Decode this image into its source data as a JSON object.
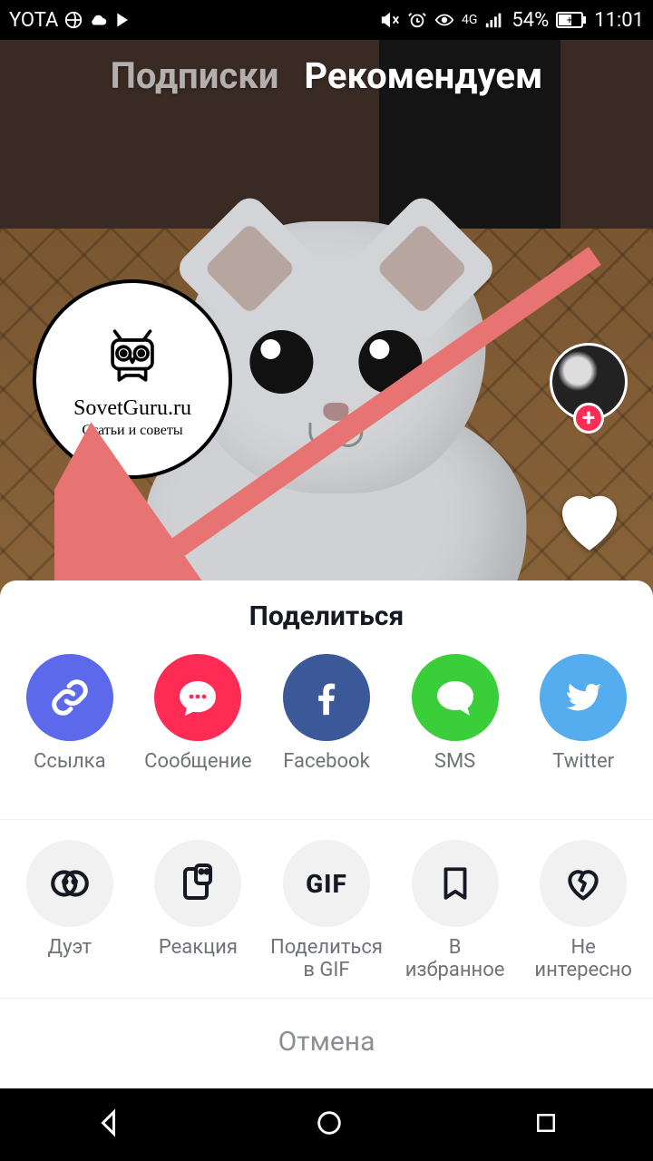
{
  "status": {
    "carrier": "YOTA",
    "network_label": "4G",
    "battery_percent": "54%",
    "time": "11:01"
  },
  "tabs": {
    "following": "Подписки",
    "for_you": "Рекомендуем",
    "active": "for_you"
  },
  "watermark": {
    "title": "SovetGuru.ru",
    "subtitle": "Статьи и советы"
  },
  "rail": {
    "add_symbol": "+"
  },
  "sheet": {
    "title": "Поделиться",
    "cancel": "Отмена",
    "row1": [
      {
        "key": "link",
        "label": "Ссылка"
      },
      {
        "key": "message",
        "label": "Сообщение"
      },
      {
        "key": "facebook",
        "label": "Facebook"
      },
      {
        "key": "sms",
        "label": "SMS"
      },
      {
        "key": "twitter",
        "label": "Twitter"
      }
    ],
    "row2": [
      {
        "key": "duet",
        "label": "Дуэт"
      },
      {
        "key": "react",
        "label": "Реакция"
      },
      {
        "key": "gif",
        "label": "Поделиться\nв GIF",
        "badge": "GIF"
      },
      {
        "key": "favorite",
        "label": "В\nизбранное"
      },
      {
        "key": "not_int",
        "label": "Не\nинтересно"
      }
    ]
  }
}
